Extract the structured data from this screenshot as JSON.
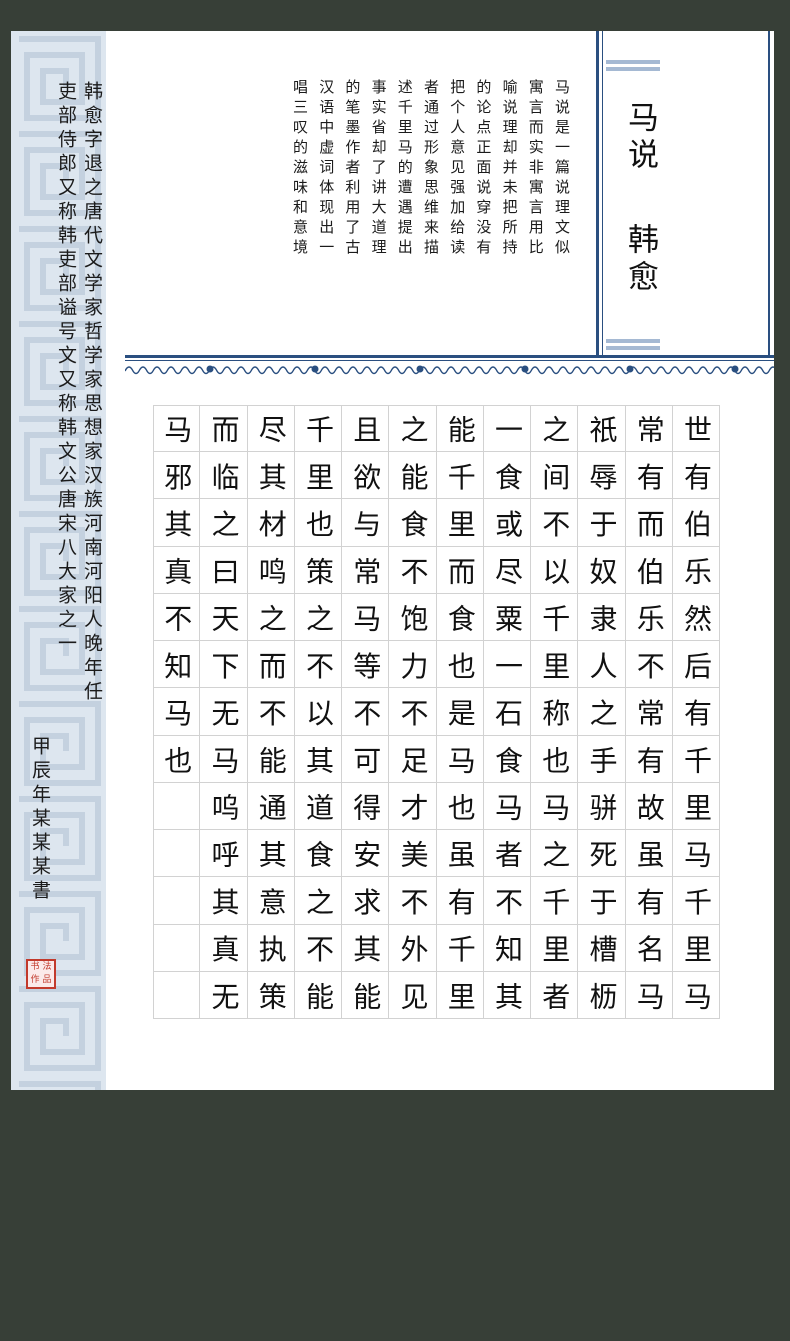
{
  "colors": {
    "background": "#373f37",
    "paper": "#ffffff",
    "border_pattern": "#dde6ef",
    "accent_blue": "#2a4f80",
    "seal_red": "#c23a2c",
    "grid_line": "#d2d2d2"
  },
  "title": {
    "col1": "马说",
    "col2": "韩愈"
  },
  "intro_columns": [
    "马说是一篇说理文似",
    "寓言而实非寓言用比",
    "喻说理却并未把所持",
    "的论点正面说穿没有",
    "把个人意见强加给读",
    "者通过形象思维来描",
    "述千里马的遭遇提出",
    "事实省却了讲大道理",
    "的笔墨作者利用了古",
    "汉语中虚词体现出一",
    "唱三叹的滋味和意境"
  ],
  "signature_columns": [
    "韩愈字退之唐代文学家哲学家思想家汉族河南河阳人晚年任",
    "吏部侍郎又称韩吏部谥号文又称韩文公唐宋八大家之一",
    "甲辰年某某某書"
  ],
  "seal": {
    "text": "书法作品"
  },
  "main_text_columns": [
    "世有伯乐然后有千里马千里马",
    "常有而伯乐不常有故虽有名马",
    "祇辱于奴隶人之手骈死于槽枥",
    "之间不以千里称也马之千里者",
    "一食或尽粟一石食马者不知其",
    "能千里而食也是马也虽有千里",
    "之能食不饱力不足才美不外见",
    "且欲与常马等不可得安求其能",
    "千里也策之不以其道食之不能",
    "尽其材鸣之而不能通其意执策",
    "而临之曰天下无马呜呼其真无",
    "马邪其真不知马也"
  ],
  "icons": [
    "meander-border-pattern",
    "wave-band-ornament",
    "red-seal-stamp"
  ]
}
